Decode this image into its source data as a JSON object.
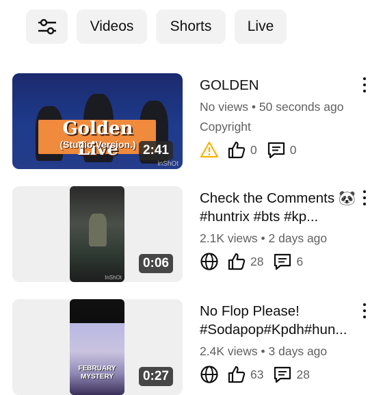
{
  "chips": {
    "filter_icon": "sliders-icon",
    "videos": "Videos",
    "shorts": "Shorts",
    "live": "Live"
  },
  "videos": [
    {
      "title": "GOLDEN",
      "views": "No views",
      "age": "50 seconds ago",
      "extra": "Copyright",
      "duration": "2:41",
      "likes": "0",
      "comments": "0",
      "status_icon": "warning-icon",
      "status_color": "#f2b400",
      "thumb_title": "Golden Live",
      "thumb_sub": "(Studio Version.)",
      "thumb_watermark": "inShOt"
    },
    {
      "title": "Check the Comments 🐼 #huntrix #bts #kp...",
      "views": "2.1K views",
      "age": "2 days ago",
      "duration": "0:06",
      "likes": "28",
      "comments": "6",
      "status_icon": "globe-icon",
      "thumb_watermark": "InShOt"
    },
    {
      "title": "No Flop Please! #Sodapop#Kpdh#hun...",
      "views": "2.4K views",
      "age": "3 days ago",
      "duration": "0:27",
      "likes": "63",
      "comments": "28",
      "status_icon": "globe-icon",
      "thumb_caption": "FEBRUARY MYSTERY"
    }
  ],
  "separator": "•"
}
